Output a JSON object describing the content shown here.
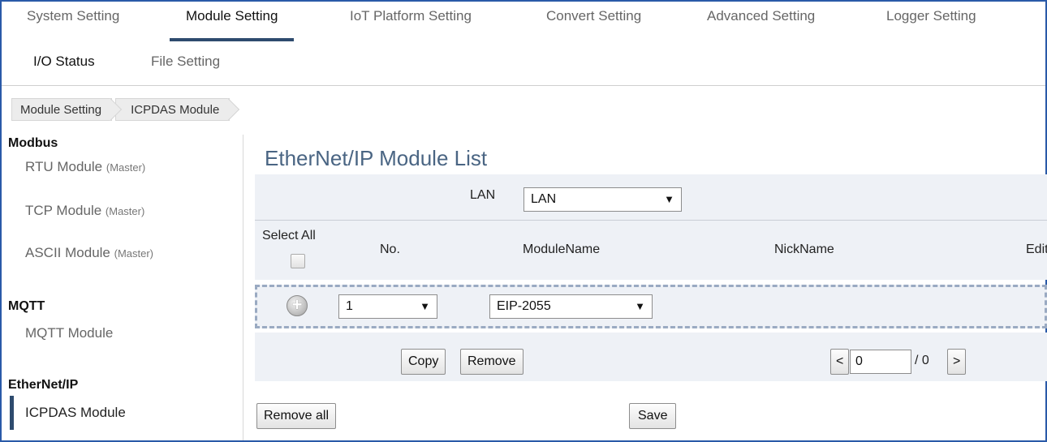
{
  "nav": {
    "tabs": [
      "System Setting",
      "Module Setting",
      "IoT Platform Setting",
      "Convert Setting",
      "Advanced Setting",
      "Logger Setting"
    ],
    "tabs2": [
      "I/O Status",
      "File Setting"
    ],
    "active_tab": "Module Setting"
  },
  "breadcrumb": [
    "Module Setting",
    "ICPDAS Module"
  ],
  "sidebar": {
    "modbus": {
      "title": "Modbus",
      "items": [
        {
          "label": "RTU Module",
          "note": "(Master)"
        },
        {
          "label": "TCP Module",
          "note": "(Master)"
        },
        {
          "label": "ASCII Module",
          "note": "(Master)"
        }
      ]
    },
    "mqtt": {
      "title": "MQTT",
      "items": [
        {
          "label": "MQTT Module"
        }
      ]
    },
    "ethernetip": {
      "title": "EtherNet/IP",
      "items": [
        {
          "label": "ICPDAS Module"
        }
      ]
    }
  },
  "main": {
    "title": "EtherNet/IP Module List",
    "lan_label": "LAN",
    "lan_value": "LAN",
    "columns": {
      "select_all": "Select All",
      "no": "No.",
      "module_name": "ModuleName",
      "nick_name": "NickName",
      "edit": "Edit"
    },
    "new_row": {
      "no_value": "1",
      "module_value": "EIP-2055"
    },
    "buttons": {
      "copy": "Copy",
      "remove": "Remove",
      "prev": "<",
      "next": ">",
      "remove_all": "Remove all",
      "save": "Save"
    },
    "pager": {
      "current": "0",
      "total": "/ 0"
    }
  },
  "icons": {
    "dropdown": "▼",
    "add": "+"
  }
}
